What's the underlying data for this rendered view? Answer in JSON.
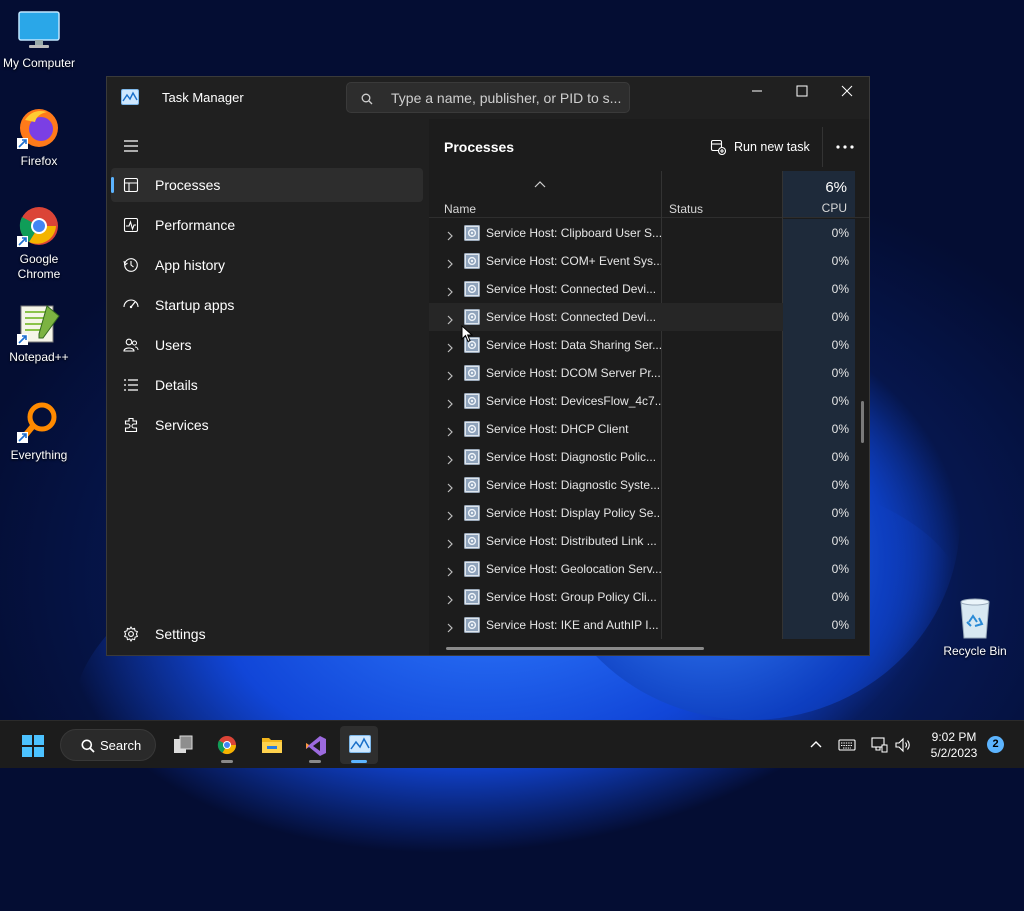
{
  "desktop": {
    "icons": [
      {
        "label": "My Computer"
      },
      {
        "label": "Firefox"
      },
      {
        "label": "Google Chrome"
      },
      {
        "label": "Notepad++"
      },
      {
        "label": "Everything"
      },
      {
        "label": "Recycle Bin"
      }
    ]
  },
  "window": {
    "title": "Task Manager",
    "search_placeholder": "Type a name, publisher, or PID to s..."
  },
  "sidebar": {
    "items": [
      {
        "label": "Processes",
        "icon": "processes-icon",
        "active": true
      },
      {
        "label": "Performance",
        "icon": "performance-icon"
      },
      {
        "label": "App history",
        "icon": "app-history-icon"
      },
      {
        "label": "Startup apps",
        "icon": "startup-apps-icon"
      },
      {
        "label": "Users",
        "icon": "users-icon"
      },
      {
        "label": "Details",
        "icon": "details-icon"
      },
      {
        "label": "Services",
        "icon": "services-icon"
      }
    ],
    "settings_label": "Settings"
  },
  "content": {
    "title": "Processes",
    "run_new_task_label": "Run new task",
    "columns": {
      "name": "Name",
      "status": "Status",
      "cpu_total": "6%",
      "cpu": "CPU"
    },
    "rows": [
      {
        "name": "Service Host: Clipboard User S...",
        "status": "",
        "cpu": "0%"
      },
      {
        "name": "Service Host: COM+ Event Sys...",
        "status": "",
        "cpu": "0%"
      },
      {
        "name": "Service Host: Connected Devi...",
        "status": "",
        "cpu": "0%"
      },
      {
        "name": "Service Host: Connected Devi...",
        "status": "",
        "cpu": "0%"
      },
      {
        "name": "Service Host: Data Sharing Ser...",
        "status": "",
        "cpu": "0%"
      },
      {
        "name": "Service Host: DCOM Server Pr...",
        "status": "",
        "cpu": "0%"
      },
      {
        "name": "Service Host: DevicesFlow_4c7...",
        "status": "",
        "cpu": "0%"
      },
      {
        "name": "Service Host: DHCP Client",
        "status": "",
        "cpu": "0%"
      },
      {
        "name": "Service Host: Diagnostic Polic...",
        "status": "",
        "cpu": "0%"
      },
      {
        "name": "Service Host: Diagnostic Syste...",
        "status": "",
        "cpu": "0%"
      },
      {
        "name": "Service Host: Display Policy Se...",
        "status": "",
        "cpu": "0%"
      },
      {
        "name": "Service Host: Distributed Link ...",
        "status": "",
        "cpu": "0%"
      },
      {
        "name": "Service Host: Geolocation Serv...",
        "status": "",
        "cpu": "0%"
      },
      {
        "name": "Service Host: Group Policy Cli...",
        "status": "",
        "cpu": "0%"
      },
      {
        "name": "Service Host: IKE and AuthIP I...",
        "status": "",
        "cpu": "0%"
      }
    ]
  },
  "taskbar": {
    "search_label": "Search",
    "time": "9:02 PM",
    "date": "5/2/2023",
    "notification_count": "2"
  },
  "colors": {
    "accent": "#5cb4ff",
    "window_bg": "#202020",
    "cpu_column_bg": "#1e2a3a"
  }
}
